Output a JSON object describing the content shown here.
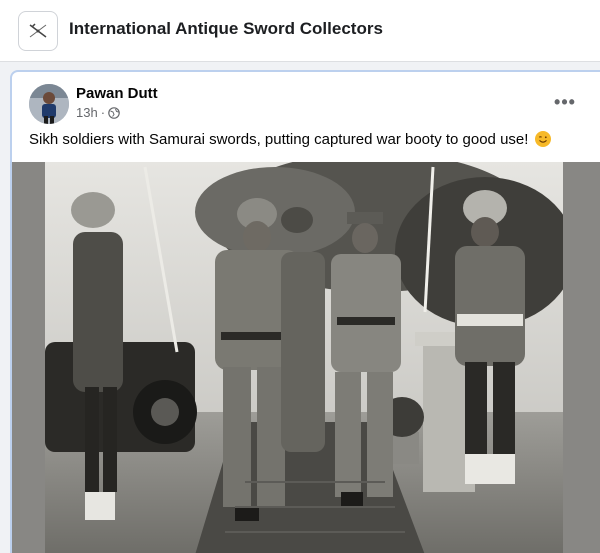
{
  "group": {
    "name": "International Antique Sword Collectors",
    "logo_icon": "crossed-swords-icon"
  },
  "post": {
    "author": "Pawan Dutt",
    "time": "13h",
    "separator": "·",
    "privacy_icon": "globe-icon",
    "more_icon": "more-options-icon",
    "more_label": "•••",
    "text": "Sikh soldiers with Samurai swords, putting captured war booty to good use!",
    "emoji": "smiling-winking-face-emoji",
    "photo_description_icon": "vintage-black-and-white-photo"
  },
  "colors": {
    "accent_border": "#bcd0ee",
    "secondary_text": "#65676b",
    "page_bg": "#f0f2f5"
  }
}
